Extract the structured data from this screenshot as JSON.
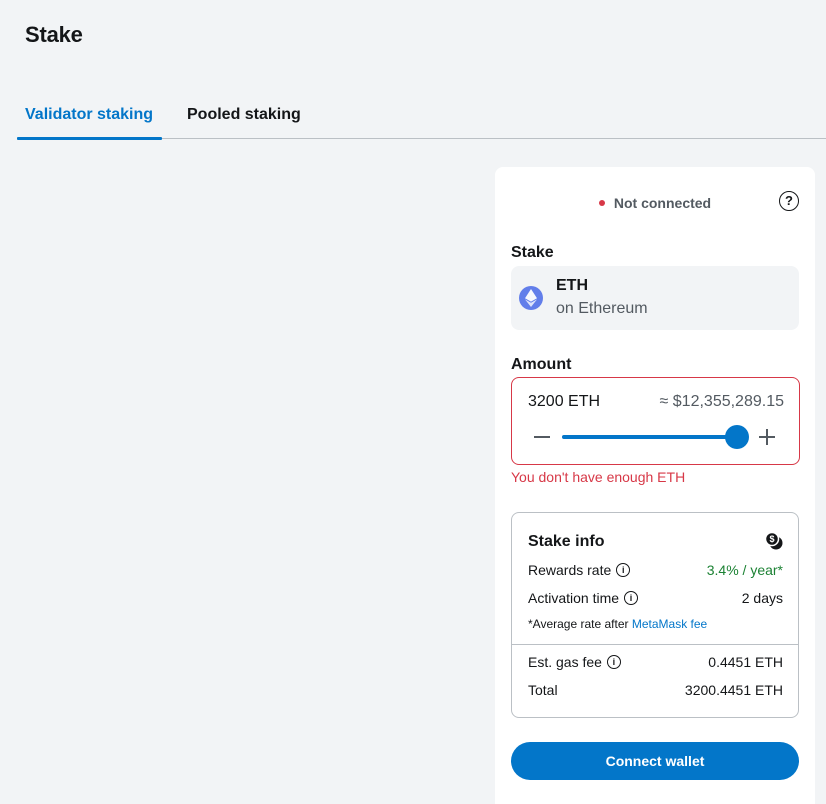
{
  "page": {
    "title": "Stake"
  },
  "tabs": [
    {
      "label": "Validator staking",
      "active": true
    },
    {
      "label": "Pooled staking",
      "active": false
    }
  ],
  "card": {
    "status": "Not connected",
    "help_icon": "question-circle-icon",
    "stake_label": "Stake",
    "token": {
      "symbol": "ETH",
      "network": "on Ethereum",
      "icon": "ethereum-icon",
      "color": "#627eea"
    },
    "amount_label": "Amount",
    "amount": {
      "value": "3200 ETH",
      "fiat": "≈ $12,355,289.15",
      "slider_percent": 100
    },
    "error": "You don't have enough ETH",
    "info": {
      "title": "Stake info",
      "rewards_label": "Rewards rate",
      "rewards_value": "3.4% / year*",
      "activation_label": "Activation time",
      "activation_value": "2 days",
      "note_prefix": "*Average rate after ",
      "note_link": "MetaMask fee",
      "gas_label": "Est. gas fee",
      "gas_value": "0.4451 ETH",
      "total_label": "Total",
      "total_value": "3200.4451 ETH"
    },
    "connect_label": "Connect wallet"
  },
  "colors": {
    "accent": "#0376c9",
    "error": "#d73847",
    "success": "#1c8234",
    "background": "#f2f4f6"
  }
}
